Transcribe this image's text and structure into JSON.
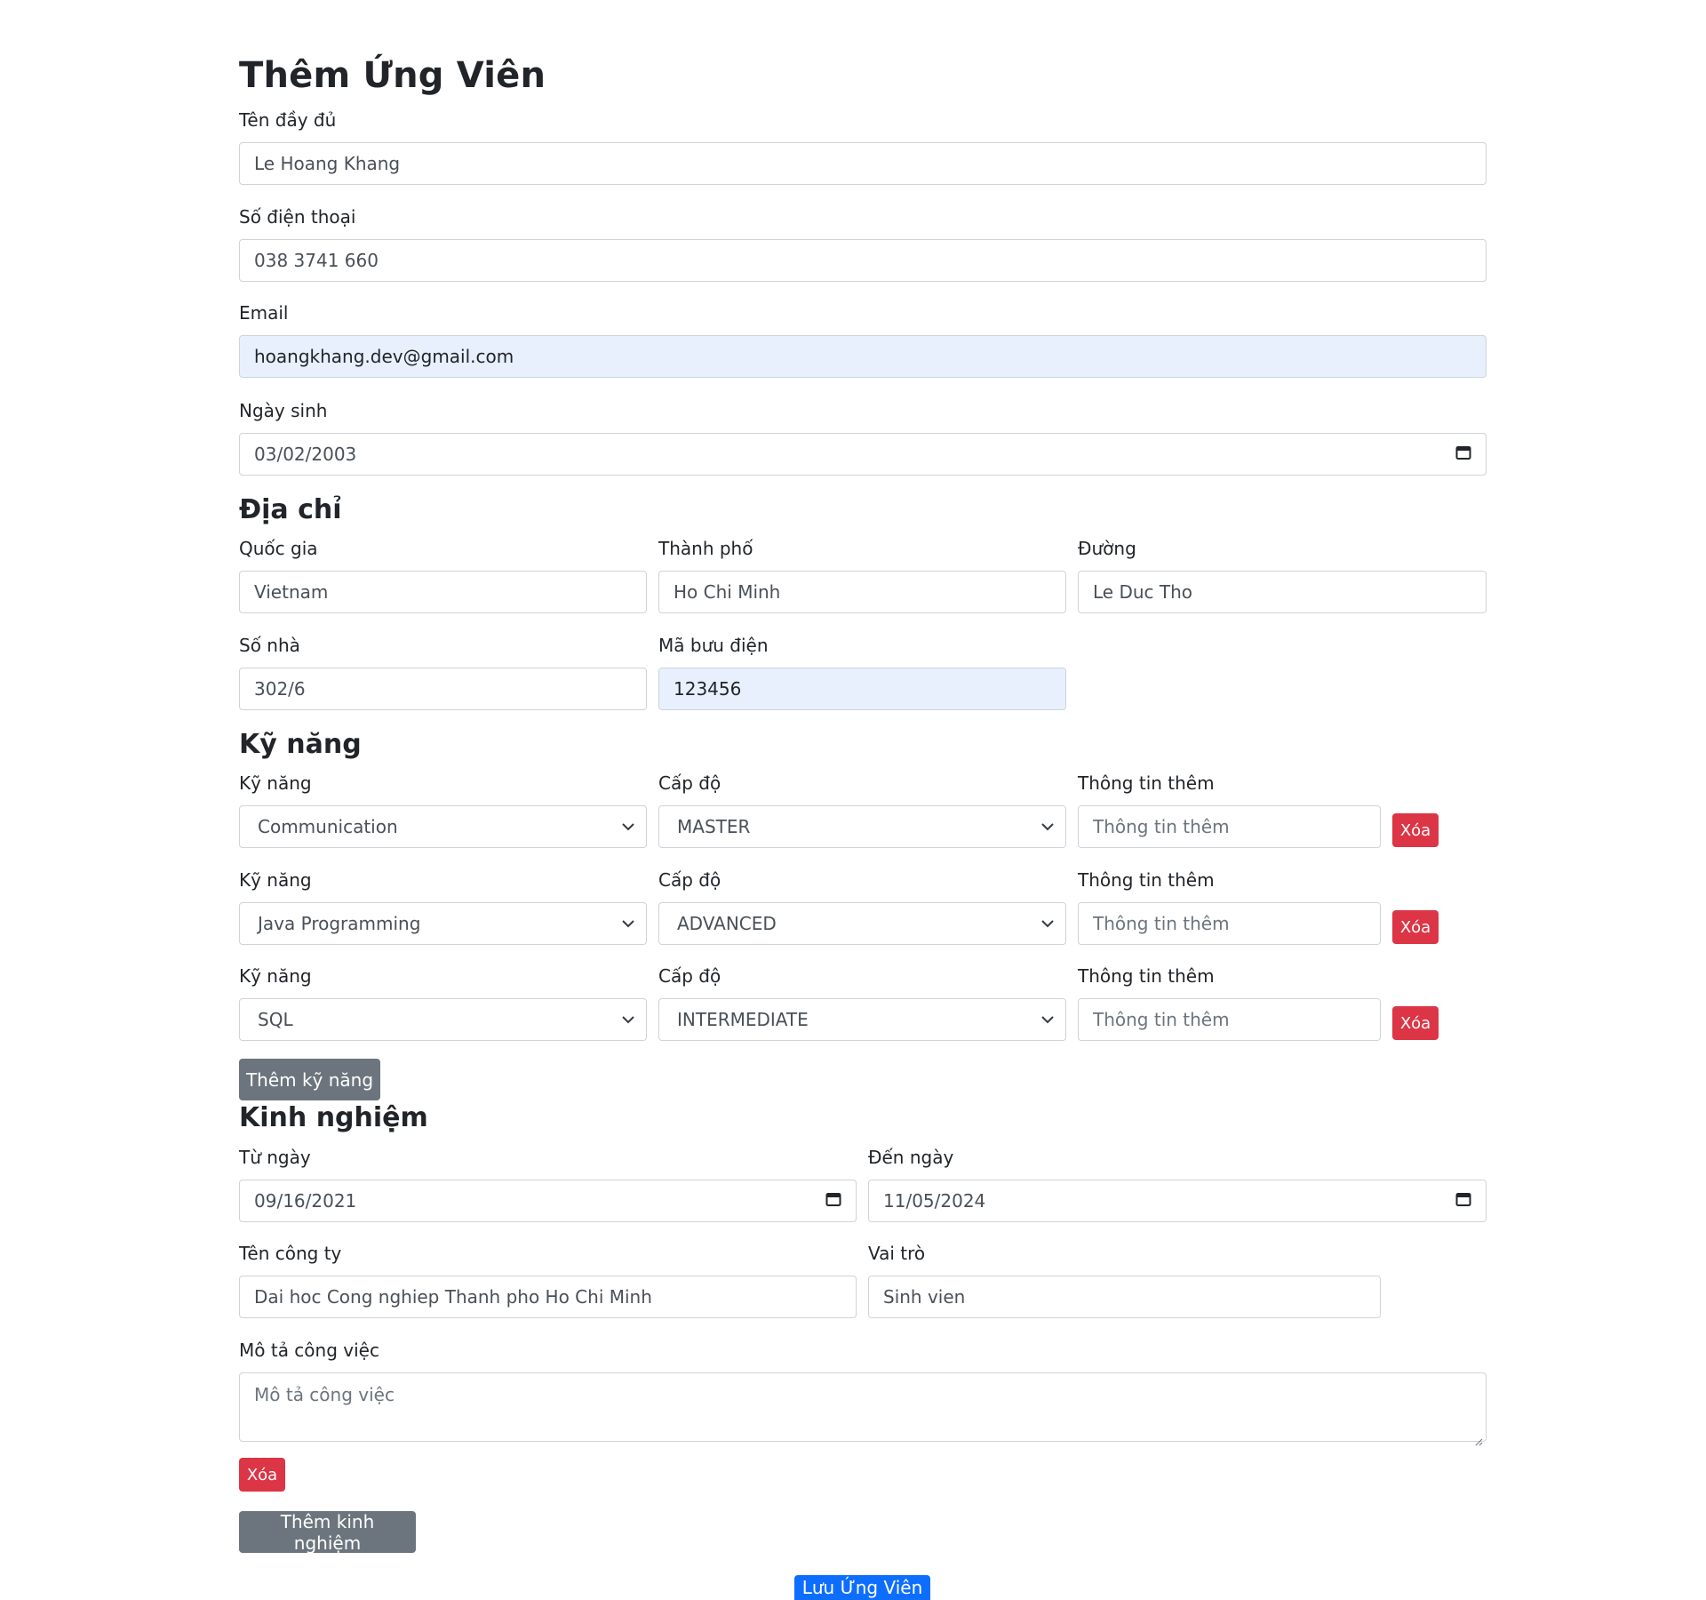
{
  "form": {
    "title": "Thêm Ứng Viên",
    "save_label": "Lưu Ứng Viên"
  },
  "personal": {
    "fullname_label": "Tên đầy đủ",
    "fullname_value": "Le Hoang Khang",
    "phone_label": "Số điện thoại",
    "phone_value": "038 3741 660",
    "email_label": "Email",
    "email_value": "hoangkhang.dev@gmail.com",
    "dob_label": "Ngày sinh",
    "dob_value": "03/02/2003"
  },
  "address": {
    "heading": "Địa chỉ",
    "country_label": "Quốc gia",
    "country_value": "Vietnam",
    "city_label": "Thành phố",
    "city_value": "Ho Chi Minh",
    "street_label": "Đường",
    "street_value": "Le Duc Tho",
    "number_label": "Số nhà",
    "number_value": "302/6",
    "zip_label": "Mã bưu điện",
    "zip_value": "123456"
  },
  "skills": {
    "heading": "Kỹ năng",
    "skill_label": "Kỹ năng",
    "level_label": "Cấp độ",
    "info_label": "Thông tin thêm",
    "info_placeholder": "Thông tin thêm",
    "delete_label": "Xóa",
    "add_label": "Thêm kỹ năng",
    "rows": [
      {
        "skill": "Communication",
        "level": "MASTER"
      },
      {
        "skill": "Java Programming",
        "level": "ADVANCED"
      },
      {
        "skill": "SQL",
        "level": "INTERMEDIATE"
      }
    ]
  },
  "experience": {
    "heading": "Kinh nghiệm",
    "from_label": "Từ ngày",
    "from_value": "09/16/2021",
    "to_label": "Đến ngày",
    "to_value": "11/05/2024",
    "company_label": "Tên công ty",
    "company_value": "Dai hoc Cong nghiep Thanh pho Ho Chi Minh",
    "role_label": "Vai trò",
    "role_value": "Sinh vien",
    "desc_label": "Mô tả công việc",
    "desc_placeholder": "Mô tả công việc",
    "delete_label": "Xóa",
    "add_label": "Thêm kinh nghiệm"
  }
}
